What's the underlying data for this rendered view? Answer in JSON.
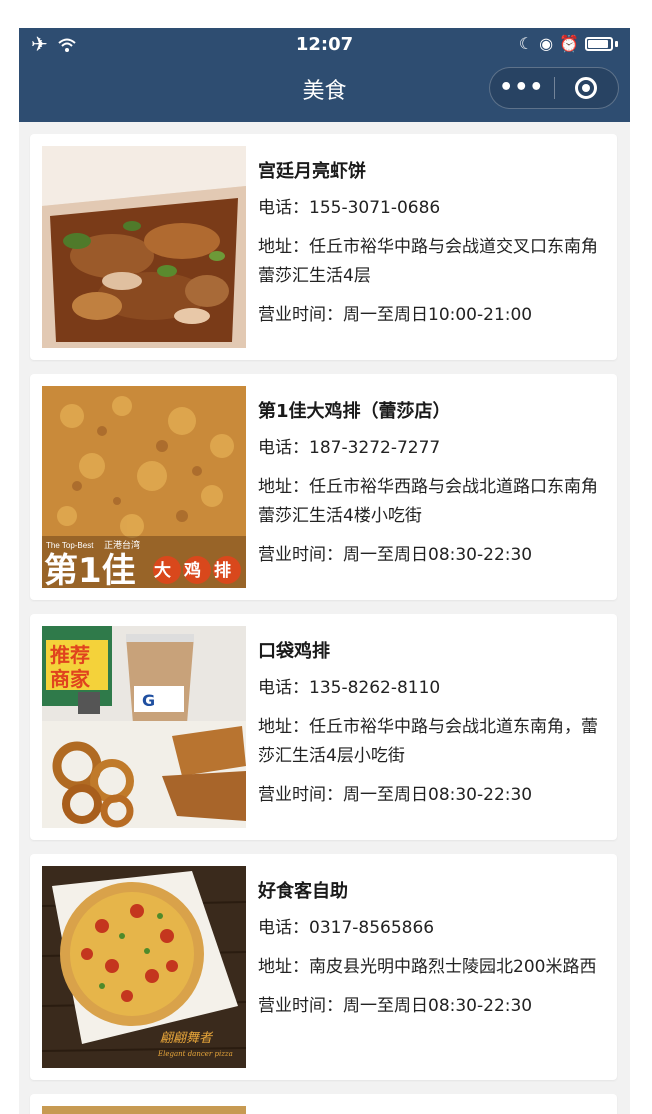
{
  "status": {
    "time": "12:07"
  },
  "nav": {
    "title": "美食",
    "more": "•••"
  },
  "labels": {
    "phone": "电话：",
    "address": "地址：",
    "hours": "营业时间："
  },
  "shops": [
    {
      "name": "宫廷月亮虾饼",
      "phone": "155-3071-0686",
      "address": "任丘市裕华中路与会战道交叉口东南角蕾莎汇生活4层",
      "hours": "周一至周日10:00-21:00"
    },
    {
      "name": "第1佳大鸡排（蕾莎店）",
      "phone": "187-3272-7277",
      "address": "任丘市裕华西路与会战北道路口东南角蕾莎汇生活4楼小吃街",
      "hours": "周一至周日08:30-22:30",
      "image_text": {
        "top_best": "The Top-Best",
        "small": "正港台湾",
        "brand": "第1佳",
        "sub": "大鸡排"
      }
    },
    {
      "name": "口袋鸡排",
      "phone": "135-8262-8110",
      "address": "任丘市裕华中路与会战北道东南角，蕾莎汇生活4层小吃街",
      "hours": "周一至周日08:30-22:30",
      "image_text": {
        "sign": "推荐商家",
        "cup": "G"
      }
    },
    {
      "name": "好食客自助",
      "phone": "0317-8565866",
      "address": "南皮县光明中路烈士陵园北200米路西",
      "hours": "周一至周日08:30-22:30",
      "image_text": {
        "logo": "翩翩舞者",
        "script": "Elegant dancer pizza"
      }
    }
  ]
}
